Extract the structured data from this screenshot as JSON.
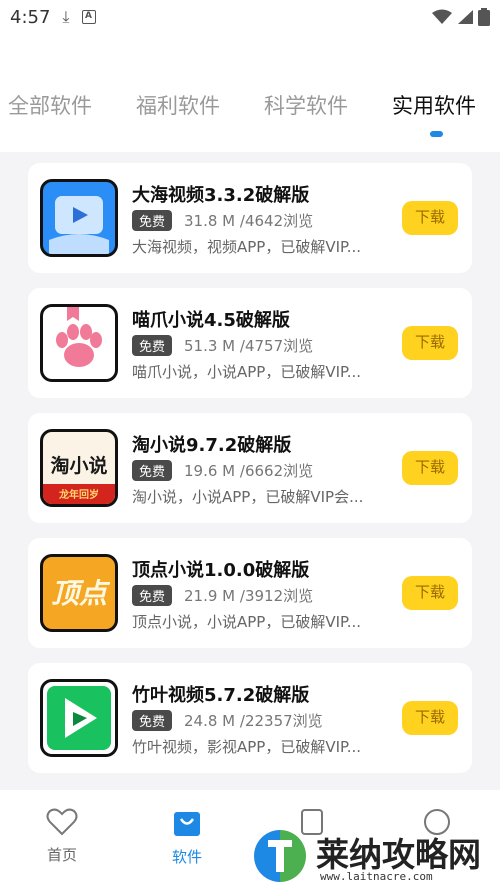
{
  "status": {
    "time": "4:57"
  },
  "tabs": [
    {
      "label": "全部软件",
      "active": false
    },
    {
      "label": "福利软件",
      "active": false
    },
    {
      "label": "科学软件",
      "active": false
    },
    {
      "label": "实用软件",
      "active": true
    }
  ],
  "accent": "#1e88e5",
  "apps": [
    {
      "name": "大海视频3.3.2破解版",
      "badge": "免费",
      "size": "31.8 M /4642浏览",
      "desc": "大海视频，视频APP，已破解VIP...",
      "button": "下载",
      "icon": "video-play-icon"
    },
    {
      "name": "喵爪小说4.5破解版",
      "badge": "免费",
      "size": "51.3 M /4757浏览",
      "desc": "喵爪小说，小说APP，已破解VIP...",
      "button": "下载",
      "icon": "cat-paw-icon"
    },
    {
      "name": "淘小说9.7.2破解版",
      "badge": "免费",
      "size": "19.6 M /6662浏览",
      "desc": "淘小说，小说APP，已破解VIP会...",
      "button": "下载",
      "icon": "taoxiaoshuo-logo",
      "icon_text": "淘小说",
      "icon_sub": "龙年回岁"
    },
    {
      "name": "顶点小说1.0.0破解版",
      "badge": "免费",
      "size": "21.9 M /3912浏览",
      "desc": "顶点小说，小说APP，已破解VIP...",
      "button": "下载",
      "icon": "dingdian-logo",
      "icon_text": "顶点"
    },
    {
      "name": "竹叶视频5.7.2破解版",
      "badge": "免费",
      "size": "24.8 M /22357浏览",
      "desc": "竹叶视频，影视APP，已破解VIP...",
      "button": "下载",
      "icon": "green-play-icon"
    }
  ],
  "nav": [
    {
      "label": "首页",
      "icon": "heart-icon",
      "active": false
    },
    {
      "label": "软件",
      "icon": "bag-icon",
      "active": true
    }
  ],
  "watermark": {
    "title": "莱纳攻略网",
    "url": "www.laitnacre.com"
  }
}
